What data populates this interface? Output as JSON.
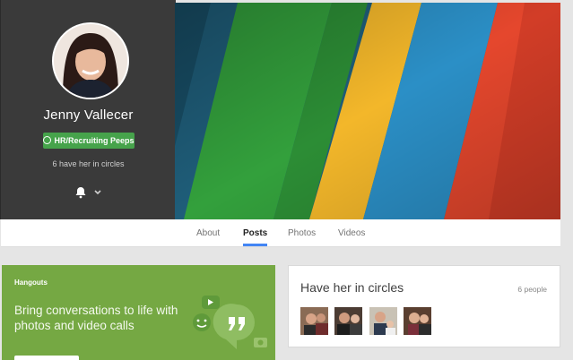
{
  "profile": {
    "name": "Jenny Vallecer",
    "circle_badge": "HR/Recruiting Peeps",
    "in_circles_text": "6 have her in circles"
  },
  "tabs": [
    {
      "label": "About",
      "active": false
    },
    {
      "label": "Posts",
      "active": true
    },
    {
      "label": "Photos",
      "active": false
    },
    {
      "label": "Videos",
      "active": false
    }
  ],
  "hangouts": {
    "title": "Hangouts",
    "tagline": "Bring conversations to life with photos and video calls"
  },
  "circles_card": {
    "title": "Have her in circles",
    "count": "6 people",
    "people": [
      "person-1",
      "person-2",
      "person-3",
      "person-4"
    ]
  },
  "colors": {
    "accent": "#4285f4",
    "badge_green": "#46a34b",
    "hangouts_green": "#75a843",
    "panel_dark": "#3a3a3a"
  }
}
